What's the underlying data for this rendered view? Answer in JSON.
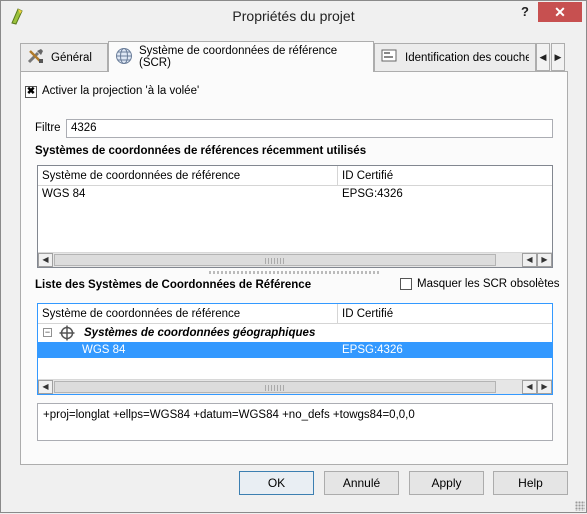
{
  "window": {
    "title": "Propriétés du projet",
    "help_label": "?",
    "close_label": "✕"
  },
  "tabs": [
    {
      "label": "Général",
      "icon": "tools-icon"
    },
    {
      "label": "Système de coordonnées de référence (SCR)",
      "icon": "globe-icon"
    },
    {
      "label": "Identification des couches",
      "icon": "identify-icon"
    }
  ],
  "tab_scroll": {
    "left": "◀",
    "right": "▶"
  },
  "otf": {
    "checked": true,
    "mark": "✖",
    "label": "Activer la projection 'à la volée'"
  },
  "filter": {
    "label": "Filtre",
    "value": "4326"
  },
  "recent": {
    "title": "Systèmes de coordonnées de références récemment utilisés",
    "columns": [
      "Système de coordonnées de référence",
      "ID Certifié"
    ],
    "rows": [
      {
        "name": "WGS 84",
        "id": "EPSG:4326"
      }
    ]
  },
  "list": {
    "title": "Liste des Systèmes de Coordonnées de Référence",
    "hide_deprecated_label": "Masquer les SCR obsolètes",
    "hide_deprecated_checked": false,
    "columns": [
      "Système de coordonnées de référence",
      "ID Certifié"
    ],
    "group": {
      "name": "Systèmes de coordonnées géographiques",
      "expander": "−"
    },
    "rows": [
      {
        "name": "WGS 84",
        "id": "EPSG:4326",
        "selected": true
      }
    ]
  },
  "proj_string": "+proj=longlat +ellps=WGS84 +datum=WGS84 +no_defs +towgs84=0,0,0",
  "scroll_arrows": {
    "left": "◀",
    "right": "▶"
  },
  "buttons": {
    "ok": "OK",
    "cancel": "Annulé",
    "apply": "Apply",
    "help": "Help"
  }
}
